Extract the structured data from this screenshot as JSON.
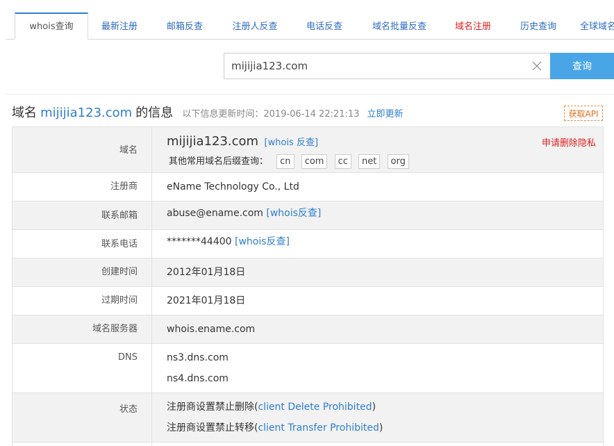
{
  "tabs": [
    {
      "label": "whois查询",
      "active": true
    },
    {
      "label": "最新注册"
    },
    {
      "label": "邮箱反查"
    },
    {
      "label": "注册人反查"
    },
    {
      "label": "电话反查"
    },
    {
      "label": "域名批量反查"
    },
    {
      "label": "域名注册",
      "highlight": "#e02020"
    },
    {
      "label": "历史查询"
    },
    {
      "label": "全球域名"
    }
  ],
  "search": {
    "value": "mijijia123.com",
    "button_label": "查询",
    "clear_icon": "close-icon"
  },
  "heading": {
    "prefix": "域名",
    "domain": "mijijia123.com",
    "suffix": "的信息",
    "update_text": "以下信息更新时间：2019-06-14 22:21:13",
    "update_link": "立即更新",
    "api_label": "获取API"
  },
  "info": {
    "domain": {
      "label": "域名",
      "name": "mijijia123.com",
      "whois_link": "[whois 反查]",
      "other_label": "其他常用域名后缀查询：",
      "suffixes": [
        "cn",
        "com",
        "cc",
        "net",
        "org"
      ],
      "privacy_link": "申请删除隐私"
    },
    "registrar": {
      "label": "注册商",
      "value": "eName Technology Co., Ltd"
    },
    "email": {
      "label": "联系邮箱",
      "value": "abuse@ename.com",
      "link": "[whois反查]"
    },
    "phone": {
      "label": "联系电话",
      "value": "*******44400",
      "link": "[whois反查]"
    },
    "created": {
      "label": "创建时间",
      "value": "2012年01月18日"
    },
    "expires": {
      "label": "过期时间",
      "value": "2021年01月18日"
    },
    "whois_server": {
      "label": "域名服务器",
      "value": "whois.ename.com"
    },
    "dns": {
      "label": "DNS",
      "values": [
        "ns3.dns.com",
        "ns4.dns.com"
      ]
    },
    "status": {
      "label": "状态",
      "items": [
        {
          "prefix": "注册商设置禁止删除(",
          "code": "client Delete Prohibited",
          "suffix": ")"
        },
        {
          "prefix": "注册商设置禁止转移(",
          "code": "client Transfer Prohibited",
          "suffix": ")"
        }
      ]
    }
  }
}
